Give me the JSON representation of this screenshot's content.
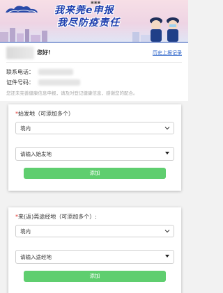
{
  "banner": {
    "slogan_line1": "我来莞e申报",
    "slogan_line2": "我尽防疫责任",
    "colors": {
      "slogan": "#1e3fae",
      "sky": "#f7dfe6"
    }
  },
  "header": {
    "greeting": "您好!",
    "history_link": "历史上报记录",
    "phone_label": "联系电话：",
    "id_label": "证件号码：",
    "notice": "您还未完善健康信息申报，请及时登记健康信息，感谢您的配合。"
  },
  "departure": {
    "star": "*",
    "title": "始发地（可添加多个）",
    "region_value": "境内",
    "place_placeholder": "请输入始发地",
    "add_label": "添加"
  },
  "transit": {
    "star": "*",
    "title": "来(返)莞途经地（可添加多个）:",
    "region_value": "境内",
    "place_placeholder": "请输入途经地",
    "add_label": "添加"
  },
  "colors": {
    "accent_green": "#5fce6f",
    "link_blue": "#2a62c9",
    "required_red": "#e0302a"
  }
}
